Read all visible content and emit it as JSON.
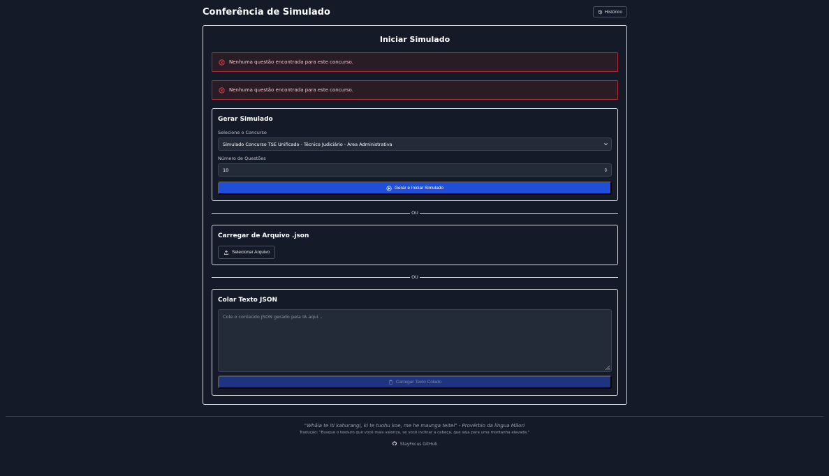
{
  "header": {
    "title": "Conferência de Simulado",
    "history_label": "Histórico"
  },
  "card": {
    "title": "Iniciar Simulado"
  },
  "alerts": [
    {
      "message": "Nenhuma questão encontrada para este concurso."
    },
    {
      "message": "Nenhuma questão encontrada para este concurso."
    }
  ],
  "generate": {
    "title": "Gerar Simulado",
    "concurso_label": "Selecione o Concurso",
    "concurso_value": "Simulado Concurso TSE Unificado - Técnico Judiciário - Área Administrativa",
    "questions_label": "Número de Questões",
    "questions_value": "10",
    "button_label": "Gerar e Iniciar Simulado"
  },
  "dividers": [
    "OU",
    "OU"
  ],
  "file_upload": {
    "title": "Carregar de Arquivo .json",
    "button_label": "Selecionar Arquivo"
  },
  "paste": {
    "title": "Colar Texto JSON",
    "placeholder": "Cole o conteúdo JSON gerado pela IA aqui...",
    "button_label": "Carregar Texto Colado"
  },
  "footer": {
    "quote": "\"Whāia te iti kahurangi, ki te tuohu koe, me he maunga teitei\" - Provérbio da língua Māori",
    "translation": "Tradução: \"Busque o tesouro que você mais valoriza, se você inclinar a cabeça, que seja para uma montanha elevada.\"",
    "github_label": "StayFocus GitHub"
  },
  "colors": {
    "background": "#141a27",
    "primary_button": "#1f4fd8",
    "disabled_button": "#1e3481",
    "alert_border": "#b52a35"
  },
  "icons": {
    "history": "history-icon",
    "alert": "x-circle-icon",
    "generate": "play-circle-icon",
    "upload": "upload-icon",
    "paste": "clipboard-icon",
    "github": "github-icon"
  }
}
